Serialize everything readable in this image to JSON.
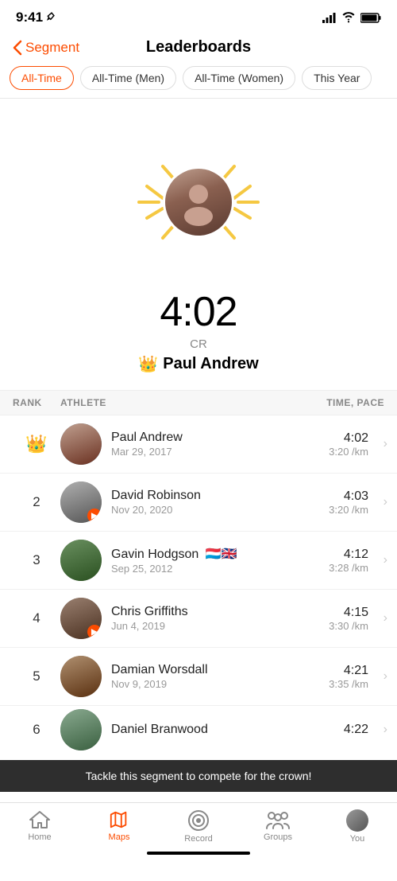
{
  "statusBar": {
    "time": "9:41",
    "locationIcon": "◂",
    "signalBars": "▂▄▆█",
    "wifi": "wifi",
    "battery": "battery"
  },
  "header": {
    "backLabel": "Segment",
    "title": "Leaderboards"
  },
  "filterTabs": [
    {
      "id": "all-time",
      "label": "All-Time",
      "active": true
    },
    {
      "id": "all-time-men",
      "label": "All-Time (Men)",
      "active": false
    },
    {
      "id": "all-time-women",
      "label": "All-Time (Women)",
      "active": false
    },
    {
      "id": "this-year",
      "label": "This Year",
      "active": false
    }
  ],
  "crownSection": {
    "time": "4:02",
    "label": "CR",
    "crownEmoji": "👑",
    "name": "Paul Andrew"
  },
  "tableHeader": {
    "rank": "RANK",
    "athlete": "ATHLETE",
    "timePace": "TIME, PACE"
  },
  "athletes": [
    {
      "rank": "crown",
      "name": "Paul Andrew",
      "date": "Mar 29, 2017",
      "time": "4:02",
      "pace": "3:20 /km",
      "avatarClass": "av1",
      "hasStravaBadge": false,
      "flags": ""
    },
    {
      "rank": "2",
      "name": "David Robinson",
      "date": "Nov 20, 2020",
      "time": "4:03",
      "pace": "3:20 /km",
      "avatarClass": "av2",
      "hasStravaBadge": true,
      "flags": ""
    },
    {
      "rank": "3",
      "name": "Gavin Hodgson",
      "date": "Sep 25, 2012",
      "time": "4:12",
      "pace": "3:28 /km",
      "avatarClass": "av3",
      "hasStravaBadge": false,
      "flags": "🇱🇺🇬🇧"
    },
    {
      "rank": "4",
      "name": "Chris Griffiths",
      "date": "Jun 4, 2019",
      "time": "4:15",
      "pace": "3:30 /km",
      "avatarClass": "av4",
      "hasStravaBadge": true,
      "flags": ""
    },
    {
      "rank": "5",
      "name": "Damian Worsdall",
      "date": "Nov 9, 2019",
      "time": "4:21",
      "pace": "3:35 /km",
      "avatarClass": "av5",
      "hasStravaBadge": false,
      "flags": ""
    },
    {
      "rank": "6",
      "name": "Daniel Branwood",
      "date": "",
      "time": "4:22",
      "pace": "",
      "avatarClass": "av6",
      "hasStravaBadge": false,
      "flags": "",
      "partial": true
    }
  ],
  "competeBanner": {
    "text": "Tackle this segment to compete for the crown!"
  },
  "bottomNav": [
    {
      "id": "home",
      "label": "Home",
      "icon": "⌂",
      "active": false
    },
    {
      "id": "maps",
      "label": "Maps",
      "icon": "maps",
      "active": true
    },
    {
      "id": "record",
      "label": "Record",
      "icon": "record",
      "active": false
    },
    {
      "id": "groups",
      "label": "Groups",
      "icon": "groups",
      "active": false
    },
    {
      "id": "you",
      "label": "You",
      "icon": "you",
      "active": false
    }
  ],
  "colors": {
    "accent": "#FC4C01",
    "crown": "#F5C842"
  }
}
